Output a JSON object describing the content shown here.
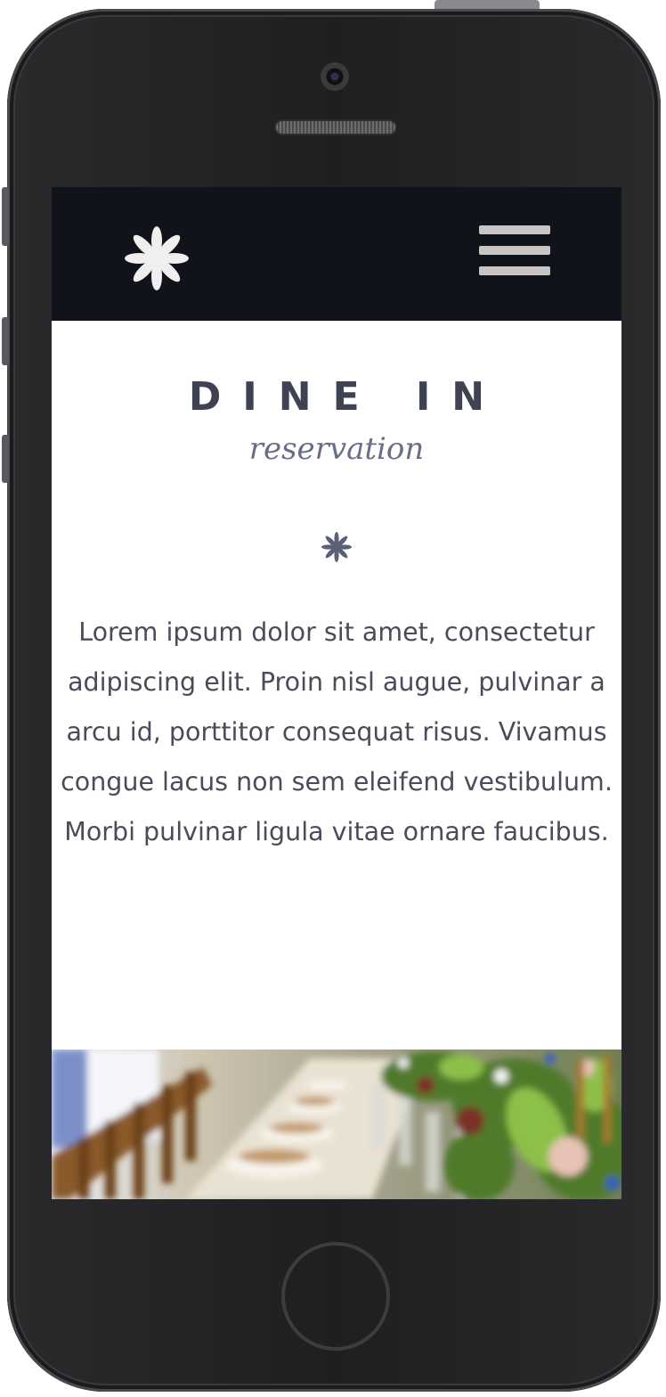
{
  "header": {
    "logo_icon": "asterisk-flower-icon",
    "menu_icon": "hamburger-menu-icon",
    "background_color": "#10131a"
  },
  "hero": {
    "title": "DINE IN",
    "subtitle": "reservation",
    "divider_icon": "asterisk-icon",
    "title_color": "#3f4252"
  },
  "content": {
    "paragraph": "Lorem ipsum dolor sit amet, consectetur adipiscing elit. Proin nisl augue, pulvinar a arcu id, porttitor consequat risus. Vivamus congue lacus non sem eleifend vestibulum. Morbi pulvinar ligula vitae ornare faucibus."
  },
  "banner": {
    "image": "long-banquet-table-photo"
  }
}
